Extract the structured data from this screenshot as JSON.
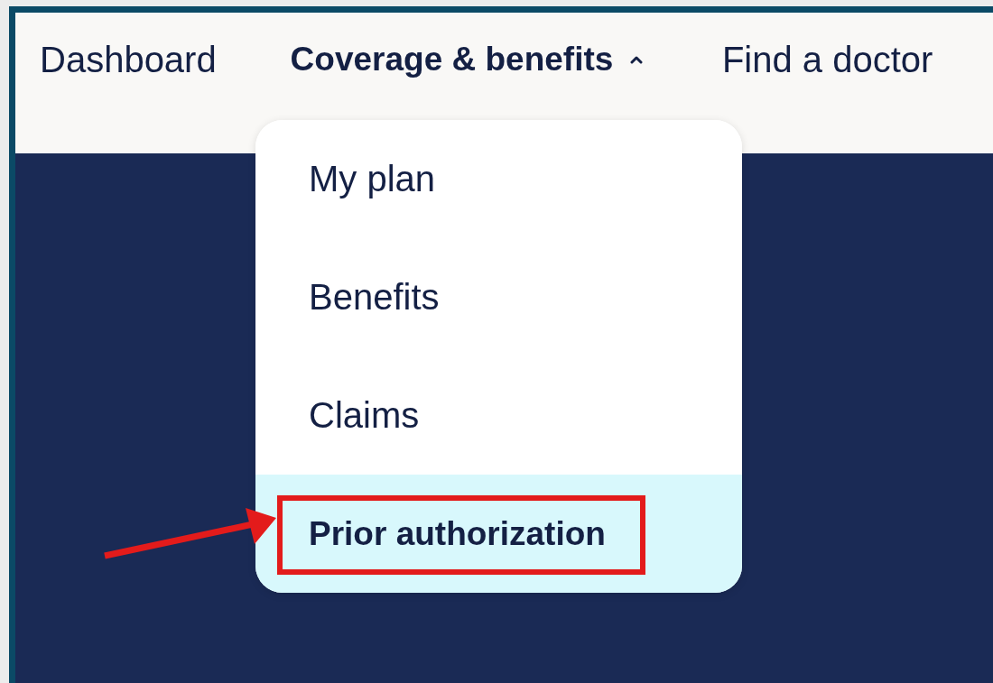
{
  "nav": {
    "items": [
      {
        "label": "Dashboard",
        "selected": false
      },
      {
        "label": "Coverage & benefits",
        "selected": true,
        "expanded": true
      },
      {
        "label": "Find a doctor",
        "selected": false
      }
    ]
  },
  "dropdown": {
    "items": [
      {
        "label": "My plan",
        "selected": false
      },
      {
        "label": "Benefits",
        "selected": false
      },
      {
        "label": "Claims",
        "selected": false
      },
      {
        "label": "Prior authorization",
        "selected": true
      }
    ]
  }
}
